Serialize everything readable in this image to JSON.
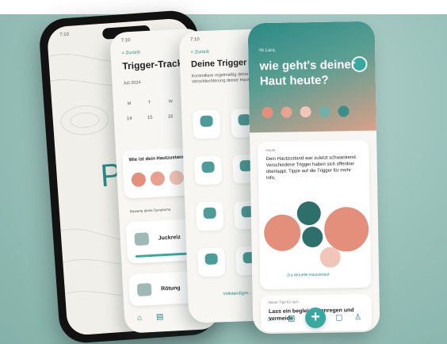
{
  "phone_main": {
    "status_time": "7:10",
    "logo_text": "Pso",
    "colors": {
      "brand": "#2b8a86",
      "screen": "#f1efe9"
    }
  },
  "screen_tracking": {
    "status_time": "7:10",
    "back_label": "< Zurück",
    "title": "Trigger-Tracking",
    "month": "Juli 2024",
    "weekdays": [
      "M",
      "T",
      "W",
      "T"
    ],
    "days": [
      "14",
      "15",
      "16",
      "17"
    ],
    "question": "Wie ist dein Hautzustand?",
    "symptoms_label": "Bewerte deine Symptome",
    "items": [
      "Juckreiz",
      "Rötung"
    ]
  },
  "screen_triggers": {
    "status_time": "7:10",
    "back_label": "< Zurück",
    "title": "Deine Trigger",
    "subtitle": "Kontrolliere regelmäßig deine Verschlechterung deiner Haut.",
    "more_link": "Vollständiges ..."
  },
  "screen_home": {
    "greeting": "Hi Lara,",
    "question": "wie geht's deiner Haut heute?",
    "insight_label": "Heute",
    "insight_text": "Dein Hautzustand war zuletzt schwankend. Verschiedene Trigger haben sich offenbar überlappt. Tippe auf die Trigger für mehr Info.",
    "link": "Zur Aktuelle Hautverlauf",
    "tip_label": "Neuer Tipp für dich",
    "tip_text": "Lass ein beglei... ... anregen und vermeide",
    "fab": "+",
    "colors": {
      "header_start": "#2b8a86",
      "header_end": "#d9a08a",
      "coral": "#e38f7c",
      "teal": "#2f6f6b"
    }
  }
}
